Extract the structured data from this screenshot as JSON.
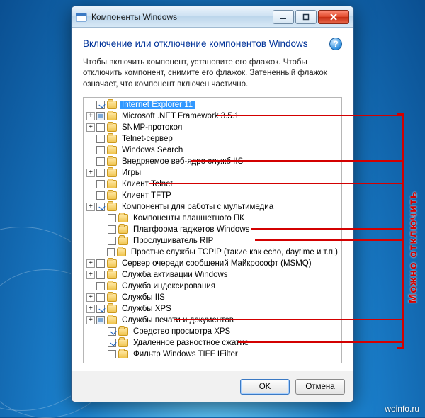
{
  "window": {
    "title": "Компоненты Windows",
    "heading": "Включение или отключение компонентов Windows",
    "explain": "Чтобы включить компонент, установите его флажок. Чтобы отключить компонент, снимите его флажок. Затененный флажок означает, что компонент включен частично.",
    "ok_label": "OK",
    "cancel_label": "Отмена"
  },
  "tree": [
    {
      "label": "Internet Explorer 11",
      "indent": 0,
      "expander": "",
      "check": "checked",
      "selected": true,
      "line": true
    },
    {
      "label": "Microsoft .NET Framework 3.5.1",
      "indent": 0,
      "expander": "+",
      "check": "partial",
      "selected": false,
      "line": false
    },
    {
      "label": "SNMP-протокол",
      "indent": 0,
      "expander": "+",
      "check": "none",
      "selected": false,
      "line": false
    },
    {
      "label": "Telnet-сервер",
      "indent": 0,
      "expander": "",
      "check": "none",
      "selected": false,
      "line": false
    },
    {
      "label": "Windows Search",
      "indent": 0,
      "expander": "",
      "check": "none",
      "selected": false,
      "line": true
    },
    {
      "label": "Внедряемое веб-ядро служб IIS",
      "indent": 0,
      "expander": "",
      "check": "none",
      "selected": false,
      "line": false
    },
    {
      "label": "Игры",
      "indent": 0,
      "expander": "+",
      "check": "none",
      "selected": false,
      "line": true
    },
    {
      "label": "Клиент Telnet",
      "indent": 0,
      "expander": "",
      "check": "none",
      "selected": false,
      "line": false
    },
    {
      "label": "Клиент TFTP",
      "indent": 0,
      "expander": "",
      "check": "none",
      "selected": false,
      "line": false
    },
    {
      "label": "Компоненты для работы с мультимедиа",
      "indent": 0,
      "expander": "+",
      "check": "checked",
      "selected": false,
      "line": false
    },
    {
      "label": "Компоненты планшетного ПК",
      "indent": 1,
      "expander": "",
      "check": "none",
      "selected": false,
      "line": true
    },
    {
      "label": "Платформа гаджетов Windows",
      "indent": 1,
      "expander": "",
      "check": "none",
      "selected": false,
      "line": true
    },
    {
      "label": "Прослушиватель RIP",
      "indent": 1,
      "expander": "",
      "check": "none",
      "selected": false,
      "line": false
    },
    {
      "label": "Простые службы TCPIP (такие как echo, daytime и т.п.)",
      "indent": 1,
      "expander": "",
      "check": "none",
      "selected": false,
      "line": false
    },
    {
      "label": "Сервер очереди сообщений Майкрософт (MSMQ)",
      "indent": 0,
      "expander": "+",
      "check": "none",
      "selected": false,
      "line": false
    },
    {
      "label": "Служба активации Windows",
      "indent": 0,
      "expander": "+",
      "check": "none",
      "selected": false,
      "line": false
    },
    {
      "label": "Служба индексирования",
      "indent": 0,
      "expander": "",
      "check": "none",
      "selected": false,
      "line": false
    },
    {
      "label": "Службы IIS",
      "indent": 0,
      "expander": "+",
      "check": "none",
      "selected": false,
      "line": false
    },
    {
      "label": "Службы XPS",
      "indent": 0,
      "expander": "+",
      "check": "checked",
      "selected": false,
      "line": true
    },
    {
      "label": "Службы печати и документов",
      "indent": 0,
      "expander": "+",
      "check": "partial",
      "selected": false,
      "line": false
    },
    {
      "label": "Средство просмотра XPS",
      "indent": 1,
      "expander": "",
      "check": "checked",
      "selected": false,
      "line": true
    },
    {
      "label": "Удаленное разностное сжатие",
      "indent": 1,
      "expander": "",
      "check": "checked",
      "selected": false,
      "line": false
    },
    {
      "label": "Фильтр Windows TIFF IFilter",
      "indent": 1,
      "expander": "",
      "check": "none",
      "selected": false,
      "line": false
    }
  ],
  "annotation": {
    "label": "Можно отключить"
  },
  "watermark": "woinfo.ru"
}
